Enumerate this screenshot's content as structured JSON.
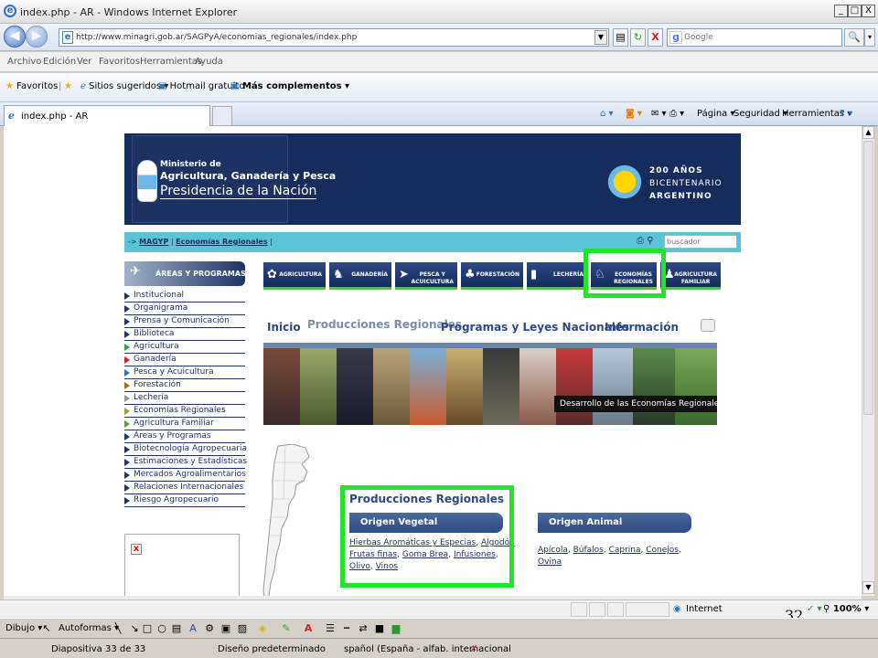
{
  "window": {
    "title": "index.php - AR - Windows Internet Explorer",
    "min": "_",
    "max": "□",
    "close": "X"
  },
  "address": {
    "back": "◀",
    "forward": "▶",
    "url": "http://www.minagri.gob.ar/SAGPyA/economias_regionales/index.php",
    "refresh": "↻",
    "stop": "X",
    "search_placeholder": "Google",
    "search_icon": "🔍"
  },
  "menu": [
    "Archivo",
    "Edición",
    "Ver",
    "Favoritos",
    "Herramientas",
    "Ayuda"
  ],
  "favorites": {
    "favoritos": "Favoritos",
    "sitios": "Sitios sugeridos ▾",
    "hotmail": "Hotmail gratuito",
    "mas": "Más complementos ▾"
  },
  "tab": {
    "label": "index.php - AR"
  },
  "tab_tools": {
    "pagina": "Página ▾",
    "seguridad": "Seguridad ▾",
    "herramientas": "Herramientas ▾",
    "help": "? ▾"
  },
  "site": {
    "ministry_line1": "Ministerio de",
    "ministry_line2": "Agricultura, Ganadería y Pesca",
    "ministry_line3": "Presidencia de la Nación",
    "bic_line1": "200 AÑOS",
    "bic_line2": "BICENTENARIO",
    "bic_line3": "ARGENTINO",
    "crumb_prefix": "-> ",
    "crumb_magyp": "MAGYP",
    "crumb_sep": " | ",
    "crumb_econ": "Economías Regionales",
    "crumb_end": " |",
    "search_placeholder": "buscador",
    "areas_title": "ÁREAS Y PROGRAMAS",
    "side_menu": [
      {
        "label": "Institucional",
        "color": "#1e3366"
      },
      {
        "label": "Organigrama",
        "color": "#1e3366"
      },
      {
        "label": "Prensa y Comunicación",
        "color": "#1e3366"
      },
      {
        "label": "Biblioteca",
        "color": "#1e3366"
      },
      {
        "label": "Agricultura",
        "color": "#3aa33a"
      },
      {
        "label": "Ganadería",
        "color": "#d42020"
      },
      {
        "label": "Pesca y Acuicultura",
        "color": "#2a73c8"
      },
      {
        "label": "Forestación",
        "color": "#a06a2a"
      },
      {
        "label": "Lechería",
        "color": "#999999"
      },
      {
        "label": "Economías Regionales",
        "color": "#9aa030"
      },
      {
        "label": "Agricultura Familiar",
        "color": "#5a9a3a"
      },
      {
        "label": "Áreas y Programas",
        "color": "#1e3366"
      },
      {
        "label": "Biotecnología Agropecuaria",
        "color": "#1e3366"
      },
      {
        "label": "Estimaciones y Estadísticas",
        "color": "#1e3366"
      },
      {
        "label": "Mercados Agroalimentarios",
        "color": "#1e3366"
      },
      {
        "label": "Relaciones Internacionales",
        "color": "#1e3366"
      },
      {
        "label": "Riesgo Agropecuario",
        "color": "#1e3366"
      }
    ],
    "categories": [
      {
        "l1": "AGRICULTURA",
        "l2": "",
        "icon": "✿"
      },
      {
        "l1": "GANADERÍA",
        "l2": "",
        "icon": "♞"
      },
      {
        "l1": "PESCA Y",
        "l2": "ACUICULTURA",
        "icon": "➤"
      },
      {
        "l1": "FORESTACIÓN",
        "l2": "",
        "icon": "♣"
      },
      {
        "l1": "LECHERÍA",
        "l2": "",
        "icon": "▮"
      },
      {
        "l1": "ECONOMÍAS",
        "l2": "REGIONALES",
        "icon": "♘"
      },
      {
        "l1": "AGRICULTURA",
        "l2": "FAMILIAR",
        "icon": "♟"
      }
    ],
    "topnav": [
      "Inicio",
      "Producciones Regionales",
      "Programas y Leyes Nacionales",
      "Información"
    ],
    "banner_tag": "Desarrollo de las Economías Regionales",
    "reg_title": "Producciones Regionales",
    "origen_vegetal": "Origen Vegetal",
    "origen_animal": "Origen Animal",
    "veg_links": [
      [
        "Hierbas Aromáticas y Especias",
        "Algodón"
      ],
      [
        "Frutas finas",
        "Goma Brea",
        "Infusiones"
      ],
      [
        "Olivo",
        "Vinos"
      ]
    ],
    "ani_links": [
      [
        "Apícola",
        "Búfalos",
        "Caprina",
        "Conejos"
      ],
      [
        "Ovina"
      ]
    ],
    "broken_img": "x"
  },
  "status": {
    "zone": "Internet",
    "zoom": "100%",
    "slide_num": "32"
  },
  "drawbar": {
    "dibujo": "Dibujo ▾",
    "autoformas": "Autoformas ▾"
  },
  "ppstatus": {
    "slide": "Diapositiva 33 de 33",
    "design": "Diseño predeterminado",
    "lang": "spañol (España - alfab. internacional"
  },
  "colors": {
    "highlight": "#22e52a",
    "site_navy": "#162c5c",
    "crumb_teal": "#5ac4d6"
  }
}
